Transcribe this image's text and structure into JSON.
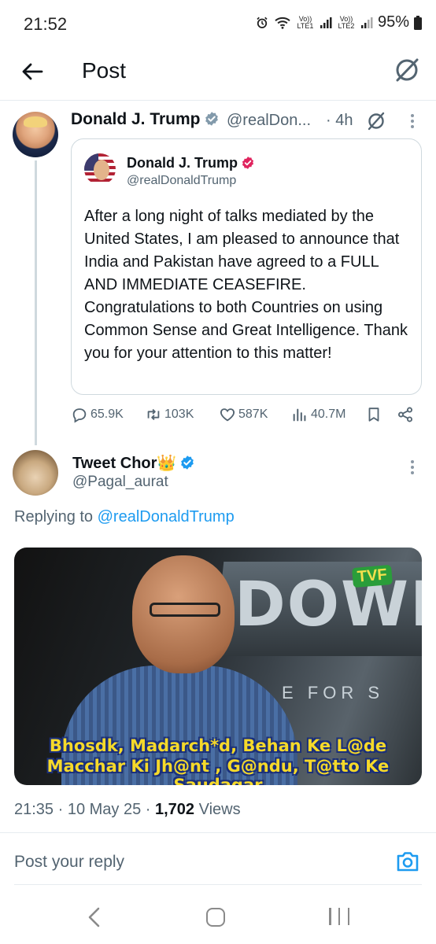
{
  "status_bar": {
    "time": "21:52",
    "sim1": "Vo)) LTE1",
    "sim2": "Vo)) LTE2",
    "battery": "95%"
  },
  "header": {
    "title": "Post",
    "back_icon": "arrow-left-icon",
    "grok_icon": "grok-icon"
  },
  "parent_post": {
    "author_name": "Donald J. Trump",
    "handle": "@realDon...",
    "time": "· 4h",
    "quoted": {
      "author_name": "Donald J. Trump",
      "handle": "@realDonaldTrump",
      "text": "After a long night of talks mediated by the United States, I am pleased to announce that India and Pakistan have agreed to a FULL AND IMMEDIATE CEASEFIRE. Congratulations to both Countries on using Common Sense and Great Intelligence. Thank you for your attention to this matter!"
    },
    "actions": {
      "replies": "65.9K",
      "reposts": "103K",
      "likes": "587K",
      "views": "40.7M"
    }
  },
  "reply_post": {
    "author_name": "Tweet Chor👑",
    "handle": "@Pagal_aurat",
    "replying_prefix": "Replying to",
    "replying_to": "@realDonaldTrump",
    "media": {
      "sign_text": "DOWN",
      "logo": "TVF",
      "background_text": "E FOR S",
      "caption_line1": "Bhosdk, Madarch*d, Behan Ke L@de",
      "caption_line2": "Macchar Ki Jh@nt , G@ndu, T@tto Ke Saudagar"
    },
    "timestamp": "21:35 · 10 May 25 ·",
    "views_count": "1,702",
    "views_label": "Views"
  },
  "reply_bar": {
    "placeholder": "Post your reply",
    "camera_icon": "camera-icon"
  },
  "colors": {
    "accent": "#1d9bf0",
    "secondary_text": "#536471",
    "primary_text": "#0f1419",
    "border": "#cfd9de"
  }
}
